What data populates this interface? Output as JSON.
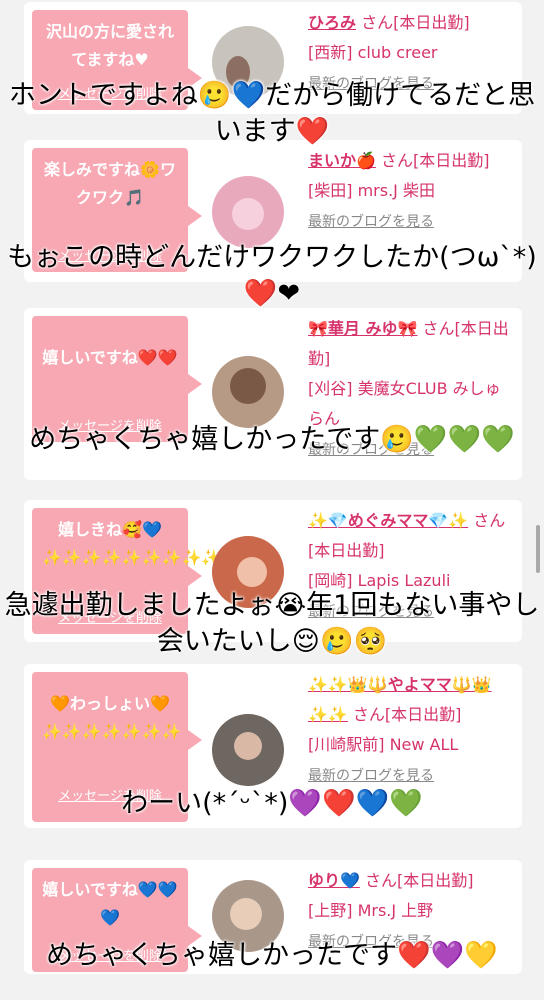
{
  "cards": [
    {
      "bubble": "沢山の方に愛されてますね♥",
      "delete_label": "メッセージを削除",
      "name": "ひろみ",
      "suffix": " さん[本日出勤]",
      "shop": "[西新] club creer",
      "blog_label": "最新のブログを見る",
      "avatar_color": "#c9c3bd"
    },
    {
      "bubble": "楽しみですね🌼ワクワク🎵",
      "delete_label": "メッセージを削除",
      "name": "まいか🍎",
      "suffix": " さん[本日出勤]",
      "shop": "[柴田] mrs.J 柴田",
      "blog_label": "最新のブログを見る",
      "avatar_color": "#e9a9bd"
    },
    {
      "bubble": "嬉しいですね❤️❤️",
      "delete_label": "メッセージを削除",
      "name": "🎀華月 みゆ🎀",
      "suffix": " さん[本日出勤]",
      "shop": "[刈谷] 美魔女CLUB みしゅらん",
      "blog_label": "最新のブログを見る",
      "avatar_color": "#b79a86"
    },
    {
      "bubble": "嬉しきね🥰💙✨✨✨✨✨✨✨✨✨",
      "delete_label": "メッセージを削除",
      "name": "✨💎めぐみママ💎✨",
      "suffix": " さん[本日出勤]",
      "shop": "[岡崎] Lapis Lazuli",
      "blog_label": "最新のブログを見る",
      "avatar_color": "#c9684a"
    },
    {
      "bubble": "🧡わっしょい🧡✨✨✨✨✨✨✨",
      "delete_label": "メッセージを削除",
      "name": "✨✨👑🔱やよママ🔱👑✨✨",
      "suffix": " さん[本日出勤]",
      "shop": "[川崎駅前] New ALL",
      "blog_label": "最新のブログを見る",
      "avatar_color": "#6e6660"
    },
    {
      "bubble": "嬉しいですね💙💙💙",
      "delete_label": "メッセージを削除",
      "name": "ゆり💙",
      "suffix": " さん[本日出勤]",
      "shop": "[上野] Mrs.J 上野",
      "blog_label": "最新のブログを見る",
      "avatar_color": "#a9978a"
    }
  ],
  "overlays": [
    "ホントですよね🥲💙だから働けてるだと思います❤️",
    "もぉこの時どんだけワクワクしたか(つω`*)❤️❤",
    "めちゃくちゃ嬉しかったです🥲💚💚💚",
    "急遽出勤しましたよぉ😭年1回もない事やし会いたいし😌🥲🥺",
    "わーい(*´ᵕ`*)💜❤️💙💚",
    "めちゃくちゃ嬉しかったです❤️💜💛"
  ]
}
